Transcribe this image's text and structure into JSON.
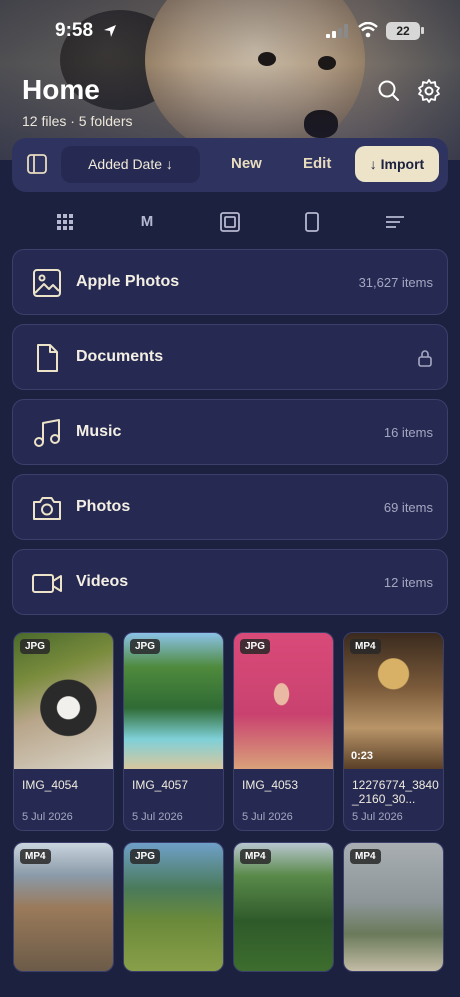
{
  "status_bar": {
    "time": "9:58",
    "battery": "22"
  },
  "header": {
    "title": "Home",
    "subtitle": "12 files · 5 folders"
  },
  "toolbar": {
    "sort_label": "Added Date ↓",
    "new_label": "New",
    "edit_label": "Edit",
    "import_label": "↓ Import"
  },
  "view_modes": [
    "grid",
    "M",
    "single",
    "device",
    "list"
  ],
  "folders": [
    {
      "name": "Apple Photos",
      "count": "31,627 items",
      "icon": "image-icon"
    },
    {
      "name": "Documents",
      "count": "",
      "icon": "document-icon",
      "locked": true
    },
    {
      "name": "Music",
      "count": "16 items",
      "icon": "music-icon"
    },
    {
      "name": "Photos",
      "count": "69 items",
      "icon": "camera-icon"
    },
    {
      "name": "Videos",
      "count": "12 items",
      "icon": "video-icon"
    }
  ],
  "files": [
    {
      "type": "JPG",
      "name": "IMG_4054",
      "date": "5 Jul 2026"
    },
    {
      "type": "JPG",
      "name": "IMG_4057",
      "date": "5 Jul 2026"
    },
    {
      "type": "JPG",
      "name": "IMG_4053",
      "date": "5 Jul 2026"
    },
    {
      "type": "MP4",
      "name": "12276774_3840_2160_30...",
      "date": "5 Jul 2026",
      "duration": "0:23"
    },
    {
      "type": "MP4"
    },
    {
      "type": "JPG"
    },
    {
      "type": "MP4"
    },
    {
      "type": "MP4"
    }
  ],
  "colors": {
    "background": "#1d2140",
    "panel": "#262a52",
    "accent": "#ece3c9"
  }
}
